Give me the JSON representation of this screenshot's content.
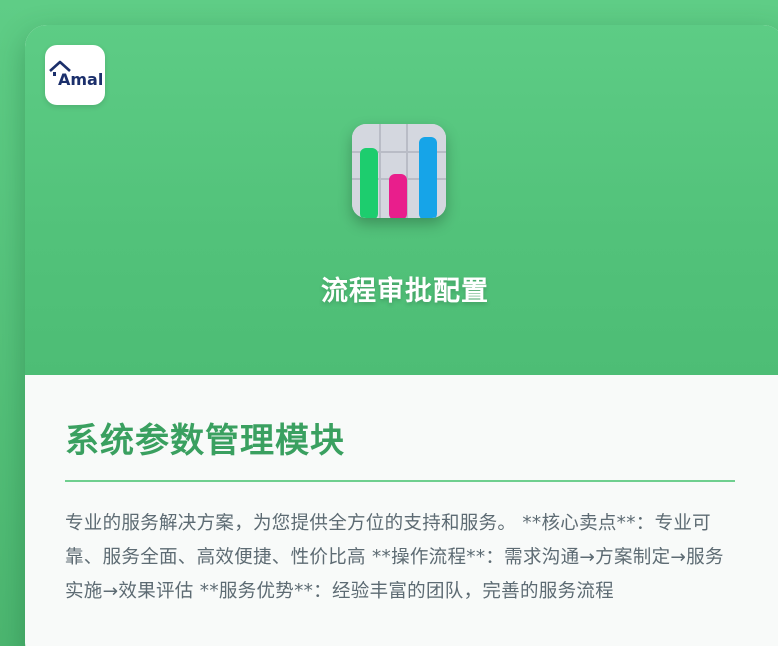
{
  "logo": {
    "text": "Amall",
    "icon": "house-roof-logo-icon"
  },
  "hero": {
    "icon": "bar-chart-icon",
    "title": "流程审批配置",
    "chart_colors": [
      "#1dcd6e",
      "#e91e8c",
      "#16a4e8"
    ]
  },
  "content": {
    "title": "系统参数管理模块",
    "description": "专业的服务解决方案，为您提供全方位的支持和服务。 **核心卖点**：专业可靠、服务全面、高效便捷、性价比高 **操作流程**：需求沟通→方案制定→服务实施→效果评估 **服务优势**：经验丰富的团队，完善的服务流程"
  },
  "colors": {
    "accent": "#3aa060",
    "hero_green": "#52c27a",
    "divider": "#6fcf8f",
    "text": "#5d6b73"
  }
}
